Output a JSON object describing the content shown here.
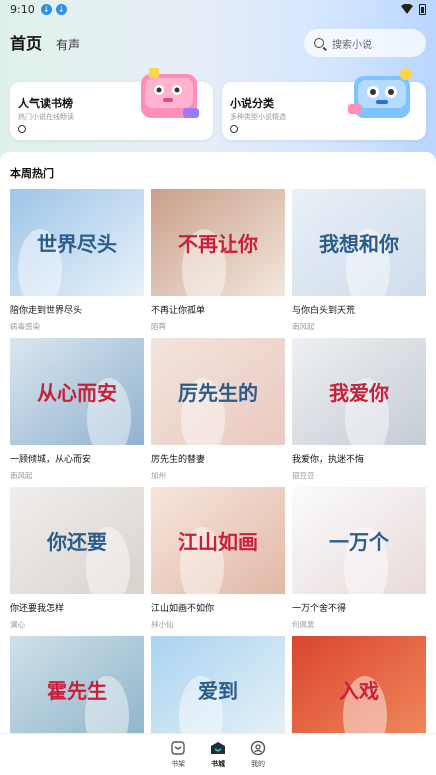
{
  "status": {
    "time": "9:10"
  },
  "header": {
    "tabs": [
      {
        "label": "首页"
      },
      {
        "label": "有声"
      }
    ],
    "search_placeholder": "搜索小说"
  },
  "promos": [
    {
      "title": "人气读书榜",
      "subtitle": "热门小说在线畅读"
    },
    {
      "title": "小说分类",
      "subtitle": "多种类型小说精选"
    }
  ],
  "section": {
    "title": "本周热门"
  },
  "books": [
    {
      "title": "陪你走到世界尽头",
      "author": "病毒感染",
      "cover_text": "世界尽头",
      "colors": [
        "#9ec5e8",
        "#e8f2fa"
      ]
    },
    {
      "title": "不再让你孤单",
      "author": "陌苒",
      "cover_text": "不再让你",
      "colors": [
        "#c9a08a",
        "#f3e6dc"
      ]
    },
    {
      "title": "与你白头到天荒",
      "author": "南风起",
      "cover_text": "我想和你",
      "colors": [
        "#e9f0f7",
        "#cfdcea"
      ]
    },
    {
      "title": "一顾倾城，从心而安",
      "author": "南风起",
      "cover_text": "从心而安",
      "colors": [
        "#dbe6ef",
        "#8fb2cf"
      ]
    },
    {
      "title": "厉先生的替妻",
      "author": "加州",
      "cover_text": "厉先生的",
      "colors": [
        "#f3e4dc",
        "#e9c9c1"
      ]
    },
    {
      "title": "我爱你，执迷不悔",
      "author": "银豆豆",
      "cover_text": "我爱你",
      "colors": [
        "#eef0f3",
        "#c5ccd4"
      ]
    },
    {
      "title": "你还要我怎样",
      "author": "澜心",
      "cover_text": "你还要",
      "colors": [
        "#f1eeec",
        "#d8d2cd"
      ]
    },
    {
      "title": "江山如画不如你",
      "author": "林小仙",
      "cover_text": "江山如画",
      "colors": [
        "#f6e6dc",
        "#e2b8a6"
      ]
    },
    {
      "title": "一万个舍不得",
      "author": "何佩禀",
      "cover_text": "一万个",
      "colors": [
        "#fbfbfb",
        "#e8dada"
      ]
    },
    {
      "title": "",
      "author": "",
      "cover_text": "霍先生",
      "colors": [
        "#cfe0ea",
        "#8db4c9"
      ]
    },
    {
      "title": "",
      "author": "",
      "cover_text": "爱到",
      "colors": [
        "#a9d3ef",
        "#e8f2f8"
      ]
    },
    {
      "title": "",
      "author": "",
      "cover_text": "入戏",
      "colors": [
        "#d9462e",
        "#f08a5d"
      ]
    }
  ],
  "nav": [
    {
      "label": "书架",
      "icon": "bookshelf-icon"
    },
    {
      "label": "书城",
      "icon": "bookstore-icon"
    },
    {
      "label": "我的",
      "icon": "profile-icon"
    }
  ],
  "colors": {
    "accent": "#2d8cf0",
    "text": "#111111",
    "muted": "#999999"
  }
}
